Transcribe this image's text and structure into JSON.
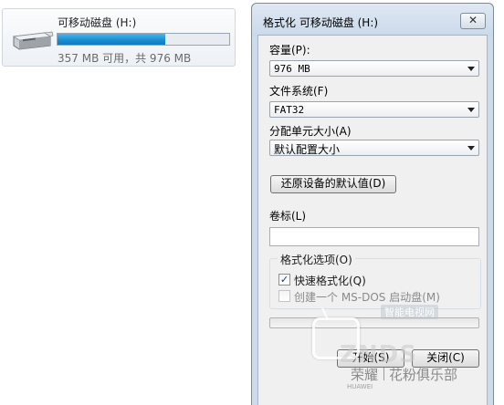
{
  "drive": {
    "name": "可移动磁盘 (H:)",
    "space_text": "357 MB 可用，共 976 MB",
    "used_fraction": 0.63,
    "icon": "usb-drive-icon"
  },
  "dialog": {
    "title": "格式化 可移动磁盘 (H:)",
    "close_symbol": "✕",
    "capacity": {
      "label": "容量(P):",
      "value": "976 MB"
    },
    "filesystem": {
      "label": "文件系统(F)",
      "value": "FAT32"
    },
    "allocation": {
      "label": "分配单元大小(A)",
      "value": "默认配置大小"
    },
    "restore_defaults": "还原设备的默认值(D)",
    "volume_label": {
      "label": "卷标(L)",
      "value": ""
    },
    "options": {
      "title": "格式化选项(O)",
      "quick_format": {
        "label": "快速格式化(Q)",
        "checked": true
      },
      "msdos_boot": {
        "label": "创建一个 MS-DOS 启动盘(M)",
        "checked": false,
        "disabled": true
      }
    },
    "progress_fraction": 0,
    "start_button": "开始(S)",
    "close_button": "关闭(C)"
  },
  "watermark": {
    "top_text": "智能电视网",
    "brand": "ZNDS",
    "club": "荣耀",
    "slogan": "花粉俱乐部",
    "logo_text": "HUAWEI"
  },
  "colors": {
    "usage_fill": "#1b8fd1",
    "dialog_frame": "#cedbea"
  }
}
